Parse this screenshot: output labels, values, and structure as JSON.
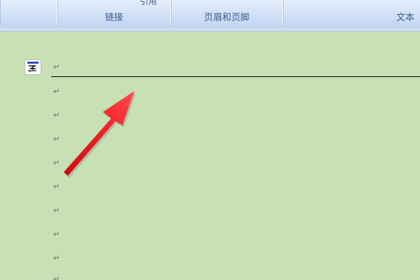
{
  "ribbon": {
    "groups": [
      {
        "label": ""
      },
      {
        "label": "链接",
        "partial_text": "引用"
      },
      {
        "label": "页眉和页脚"
      },
      {
        "label": "文本"
      }
    ]
  },
  "document": {
    "paragraph_mark": "↵",
    "header_icon": "header-footer-icon"
  },
  "colors": {
    "page": "#c7e0b4",
    "arrow": "#e8141a",
    "ribbon_text": "#3b5b8f"
  }
}
